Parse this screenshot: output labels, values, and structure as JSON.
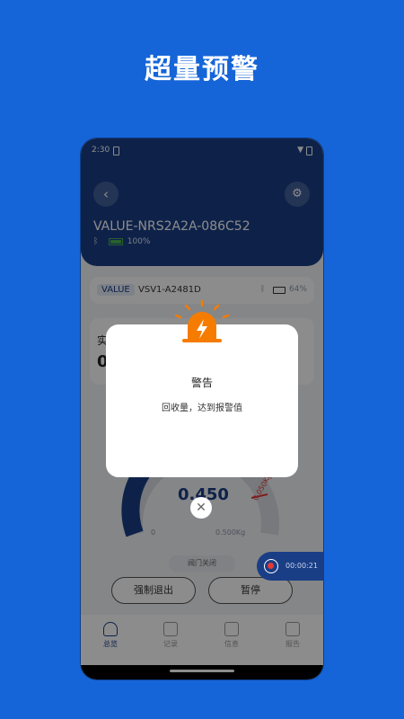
{
  "banner": {
    "title": "超量预警"
  },
  "status_bar": {
    "time": "2:30"
  },
  "header": {
    "back_icon": "chevron-left-icon",
    "settings_icon": "gear-icon",
    "device_name": "VALUE-NRS2A2A-086C52",
    "battery_percent": "100%"
  },
  "device_card": {
    "brand_tag": "VALUE",
    "model": "VSV1-A2481D",
    "battery_percent": "64%"
  },
  "stats_card": {
    "label_partial": "实",
    "value_partial": "0"
  },
  "gauge": {
    "value": "0.450",
    "min_label": "0",
    "max_label": "0.500Kg",
    "alarm_label": "0.050Kg",
    "status_text": "阀门关闭",
    "fill_fraction": 0.9
  },
  "buttons": {
    "force_exit": "强制退出",
    "pause": "暂停"
  },
  "timer": {
    "time": "00:00:21"
  },
  "tabs": [
    {
      "label": "总览",
      "icon": "dashboard-icon"
    },
    {
      "label": "记录",
      "icon": "edit-icon"
    },
    {
      "label": "信息",
      "icon": "book-icon"
    },
    {
      "label": "报告",
      "icon": "report-icon"
    }
  ],
  "dialog": {
    "icon": "alarm-light-icon",
    "title": "警告",
    "message": "回收量，达到报警值",
    "close_icon": "close-icon"
  },
  "colors": {
    "background": "#1565d8",
    "header": "#1a3e86",
    "alarm": "#f57c00"
  }
}
